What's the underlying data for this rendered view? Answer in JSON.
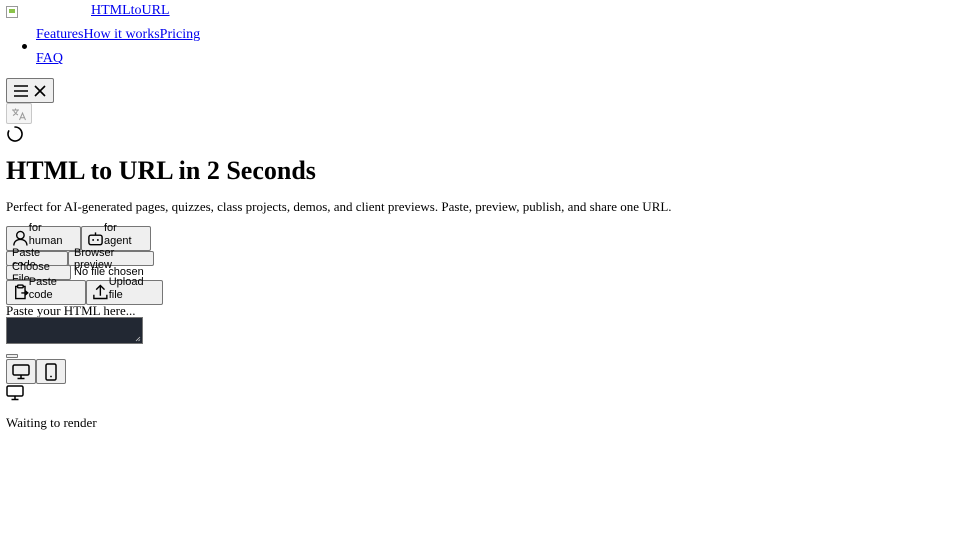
{
  "nav": {
    "brand": "HTMLtoURL",
    "links": [
      "Features",
      "How it works",
      "Pricing"
    ],
    "faq": "FAQ"
  },
  "hero": {
    "title": "HTML to URL in 2 Seconds",
    "subtitle": "Perfect for AI-generated pages, quizzes, class projects, demos, and client previews. Paste, preview, publish, and share one URL."
  },
  "audience": {
    "human": "for human",
    "agent": "for agent"
  },
  "mode_tabs": {
    "paste": "Paste code",
    "preview": "Browser preview"
  },
  "file_input": {
    "button": "Choose File",
    "status": "No file chosen"
  },
  "source_buttons": {
    "paste": "Paste code",
    "upload": "Upload file"
  },
  "editor": {
    "label": "Paste your HTML here...",
    "value": ""
  },
  "preview": {
    "status": "Waiting to render"
  },
  "icons": {
    "menu": "menu-icon",
    "close": "close-icon",
    "translate": "translate-icon",
    "spinner": "spinner-icon",
    "user": "user-icon",
    "robot": "robot-icon",
    "clipboard": "clipboard-icon",
    "upload": "upload-icon",
    "desktop": "desktop-icon",
    "mobile": "mobile-icon"
  },
  "colors": {
    "link": "#0000ee",
    "editor_bg": "#222833"
  }
}
